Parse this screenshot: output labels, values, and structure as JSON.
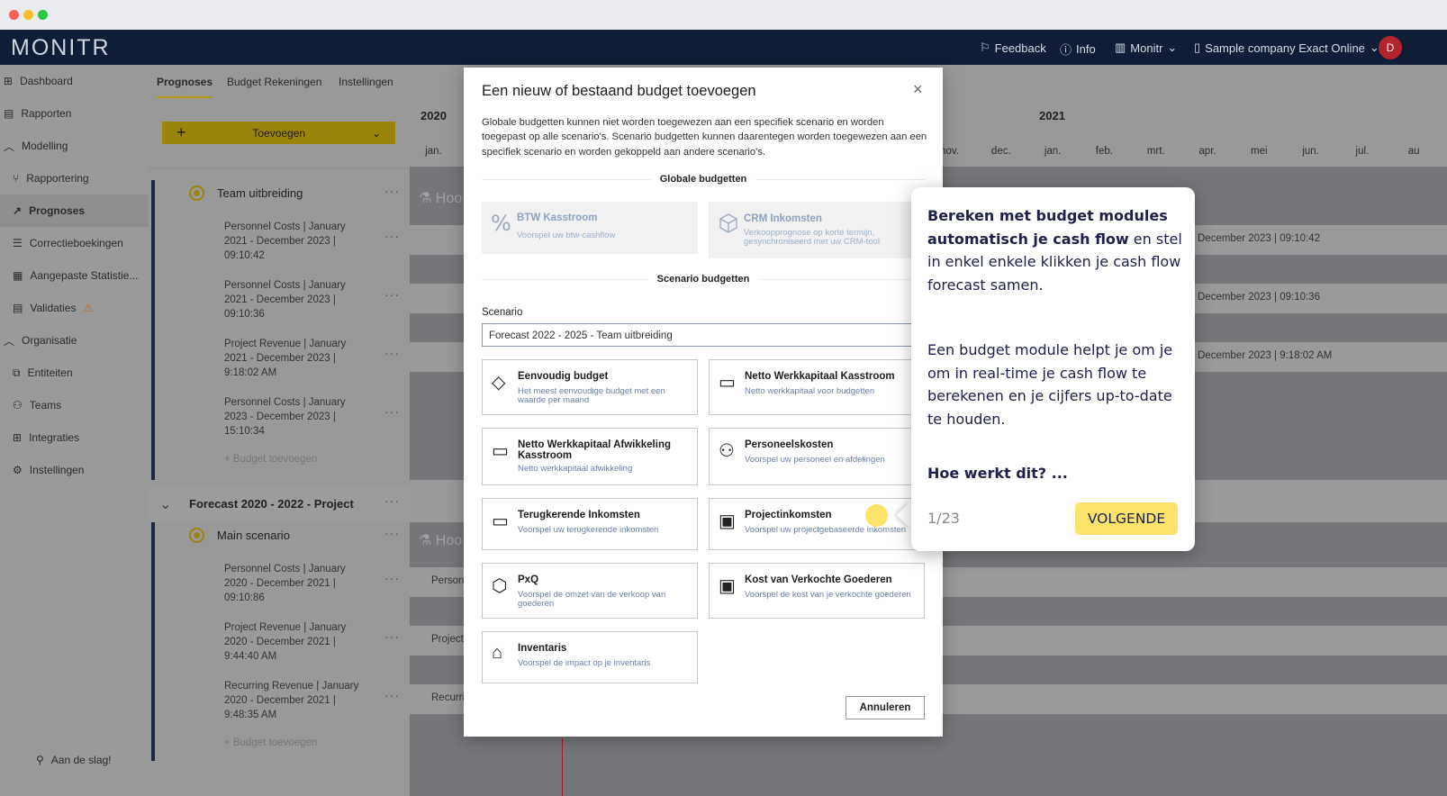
{
  "app": {
    "logo": "MONITR"
  },
  "header": {
    "feedback": "Feedback",
    "info": "Info",
    "monitr": "Monitr",
    "company": "Sample company Exact Online",
    "avatar": "D"
  },
  "sidebar": {
    "items": [
      {
        "label": "Dashboard"
      },
      {
        "label": "Rapporten"
      },
      {
        "label": "Modelling"
      },
      {
        "label": "Rapportering"
      },
      {
        "label": "Prognoses"
      },
      {
        "label": "Correctieboekingen"
      },
      {
        "label": "Aangepaste Statistie..."
      },
      {
        "label": "Validaties"
      },
      {
        "label": "Organisatie"
      },
      {
        "label": "Entiteiten"
      },
      {
        "label": "Teams"
      },
      {
        "label": "Integraties"
      },
      {
        "label": "Instellingen"
      }
    ],
    "footer": "Aan de slag!"
  },
  "tabs": [
    "Prognoses",
    "Budget Rekeningen",
    "Instellingen"
  ],
  "add_button": "Toevoegen",
  "groups": [
    {
      "scenario": "Team uitbreiding",
      "items": [
        "Personnel Costs | January 2021 - December 2023 | 09:10:42",
        "Personnel Costs | January 2021 - December 2023 | 09:10:36",
        "Project Revenue | January 2021 - December 2023 | 9:18:02 AM",
        "Personnel Costs | January 2023 - December 2023 | 15:10:34"
      ],
      "add": "Budget toevoegen"
    },
    {
      "forecast": "Forecast 2020 - 2022 - Project",
      "scenario": "Main scenario",
      "items": [
        "Personnel Costs | January 2020 - December 2021 | 09:10:86",
        "Project Revenue | January 2020 - December 2021 | 9:44:40 AM",
        "Recurring Revenue | January 2020 - December 2021 | 9:48:35 AM"
      ],
      "add": "Budget toevoegen"
    }
  ],
  "timeline": {
    "years": [
      "2020",
      "2021"
    ],
    "months_left": [
      "jan."
    ],
    "months_right": [
      "nov.",
      "dec.",
      "jan.",
      "feb.",
      "mrt.",
      "apr.",
      "mei",
      "jun.",
      "jul.",
      "au"
    ],
    "row_label": "Hoo",
    "bands_right": [
      "December 2023 | 09:10:42",
      "December 2023 | 09:10:36",
      "December 2023 | 9:18:02 AM"
    ],
    "bands_left": [
      "Personn",
      "Project",
      "Recurri"
    ]
  },
  "modal": {
    "title": "Een nieuw of bestaand budget toevoegen",
    "description": "Globale budgetten kunnen niet worden toegewezen aan een specifiek scenario en worden toegepast op alle scenario's. Scenario budgetten kunnen daarentegen worden toegewezen aan een specifiek scenario en worden gekoppeld aan andere scenario's.",
    "global_section": "Globale budgetten",
    "scenario_section": "Scenario budgetten",
    "scenario_label": "Scenario",
    "scenario_value": "Forecast 2022 - 2025 - Team uitbreiding",
    "global_cards": [
      {
        "title": "BTW Kasstroom",
        "desc": "Voorspel uw btw-cashflow"
      },
      {
        "title": "CRM Inkomsten",
        "desc": "Verkoopprognose op korte termijn, gesynchroniseerd met uw CRM-tool"
      }
    ],
    "cards": [
      {
        "title": "Eenvoudig budget",
        "desc": "Het meest eenvoudige budget met een waarde per maand"
      },
      {
        "title": "Netto Werkkapitaal Kasstroom",
        "desc": "Netto werkkapitaal voor budgetten"
      },
      {
        "title": "Netto Werkkapitaal Afwikkeling Kasstroom",
        "desc": "Netto werkkapitaal afwikkeling"
      },
      {
        "title": "Personeelskosten",
        "desc": "Voorspel uw personeel en afdelingen"
      },
      {
        "title": "Terugkerende Inkomsten",
        "desc": "Voorspel uw terugkerende inkomsten"
      },
      {
        "title": "Projectinkomsten",
        "desc": "Voorspel uw projectgebaseerde inkomsten"
      },
      {
        "title": "PxQ",
        "desc": "Voorspel de omzet van de verkoop van goederen"
      },
      {
        "title": "Kost van Verkochte Goederen",
        "desc": "Voorspel de kost van je verkochte goederen"
      },
      {
        "title": "Inventaris",
        "desc": "Voorspel de impact op je inventaris"
      }
    ],
    "cancel": "Annuleren"
  },
  "tour": {
    "bold": "Bereken met budget modules automatisch je cash flow",
    "rest": " en stel in enkel enkele klikken je cash flow forecast samen.",
    "para2": "Een budget module helpt je om je om in real-time je cash flow te berekenen en je cijfers up-to-date te houden.",
    "question": "Hoe werkt dit? ...",
    "progress": "1/23",
    "next": "VOLGENDE"
  },
  "colors": {
    "accent": "#fde36a",
    "brand": "#0f1e36",
    "avatar": "#b3232a"
  }
}
